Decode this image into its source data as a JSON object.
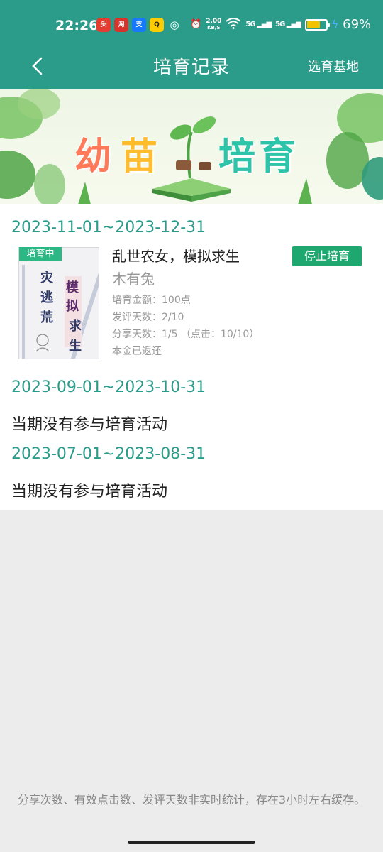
{
  "status": {
    "time": "22:26",
    "net_speed_value": "2.00",
    "net_speed_unit": "KB/S",
    "signal1": "5G",
    "signal2": "5G",
    "battery_percent": "69%",
    "battery_level": 0.69
  },
  "header": {
    "title": "培育记录",
    "action": "选育基地"
  },
  "banner": {
    "chars": [
      "幼",
      "苗",
      "培",
      "育"
    ],
    "colors": [
      "#ff7a59",
      "#ffbc2e",
      "#2ec4a9",
      "#2ec4a9"
    ]
  },
  "records": [
    {
      "period": "2023-11-01~2023-12-31",
      "book": {
        "tag": "培育中",
        "cover_text_left": [
          "灾",
          "逃",
          "荒"
        ],
        "cover_text_right": [
          "模",
          "拟",
          "求",
          "生"
        ],
        "name": "乱世农女，模拟求生",
        "author": "木有兔",
        "amount": "培育金额：100点",
        "review_days": "发评天数：2/10",
        "share_days": "分享天数：1/5 （点击：10/10）",
        "refund": "本金已返还",
        "action": "停止培育"
      }
    },
    {
      "period": "2023-09-01~2023-10-31",
      "empty_text": "当期没有参与培育活动"
    },
    {
      "period": "2023-07-01~2023-08-31",
      "empty_text": "当期没有参与培育活动"
    }
  ],
  "footnote": "分享次数、有效点击数、发评天数非实时统计，存在3小时左右缓存。"
}
